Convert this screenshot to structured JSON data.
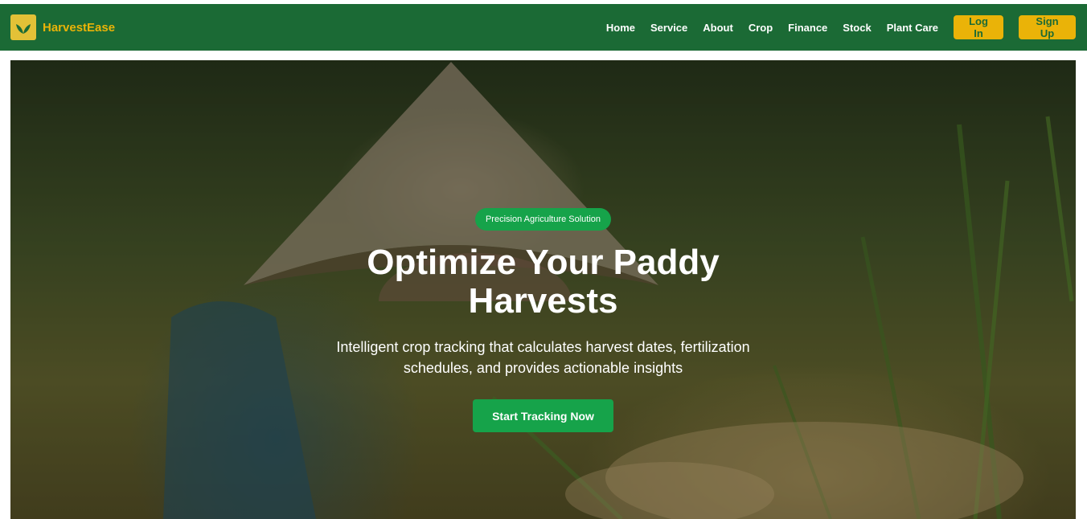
{
  "brand": {
    "name": "HarvestEase",
    "logo_icon": "leaf-icon"
  },
  "nav": {
    "links": [
      "Home",
      "Service",
      "About",
      "Crop",
      "Finance",
      "Stock",
      "Plant Care"
    ],
    "login_label": "Log In",
    "signup_label": "Sign Up"
  },
  "hero": {
    "badge": "Precision Agriculture Solution",
    "headline": "Optimize Your Paddy Harvests",
    "subtext": "Intelligent crop tracking that calculates harvest dates, fertilization schedules, and provides actionable insights",
    "cta_label": "Start Tracking Now"
  },
  "colors": {
    "navbar": "#1b6a35",
    "accent_yellow": "#eab308",
    "accent_green": "#16a34a"
  }
}
